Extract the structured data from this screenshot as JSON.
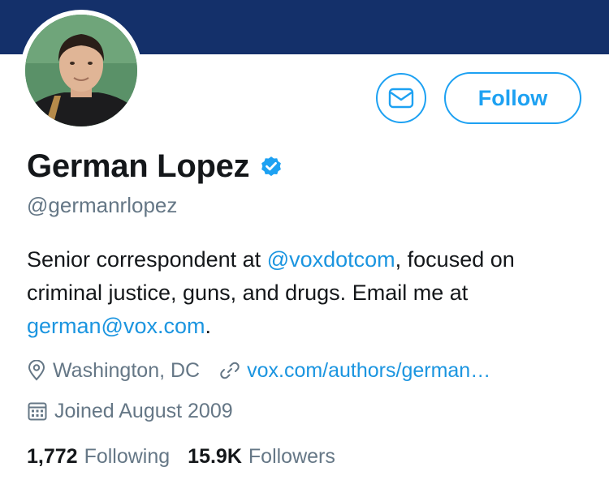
{
  "profile": {
    "display_name": "German Lopez",
    "handle": "@germanrlopez",
    "bio": {
      "text_1": "Senior correspondent at ",
      "mention": "@voxdotcom",
      "text_2": ", focused on criminal justice, guns, and drugs. Email me at ",
      "email": "german@vox.com",
      "text_3": "."
    },
    "location": "Washington, DC",
    "website": "vox.com/authors/german…",
    "joined": "Joined August 2009",
    "following_count": "1,772",
    "following_label": "Following",
    "followers_count": "15.9K",
    "followers_label": "Followers"
  },
  "actions": {
    "follow_label": "Follow"
  },
  "icons": {
    "message": "mail-icon",
    "verified": "verified-badge-icon",
    "location": "map-pin-icon",
    "website": "link-icon",
    "joined": "calendar-icon"
  },
  "colors": {
    "banner": "#14306a",
    "accent": "#1da1f2",
    "link": "#1b95e0",
    "secondary_text": "#657786",
    "primary_text": "#14171a"
  }
}
